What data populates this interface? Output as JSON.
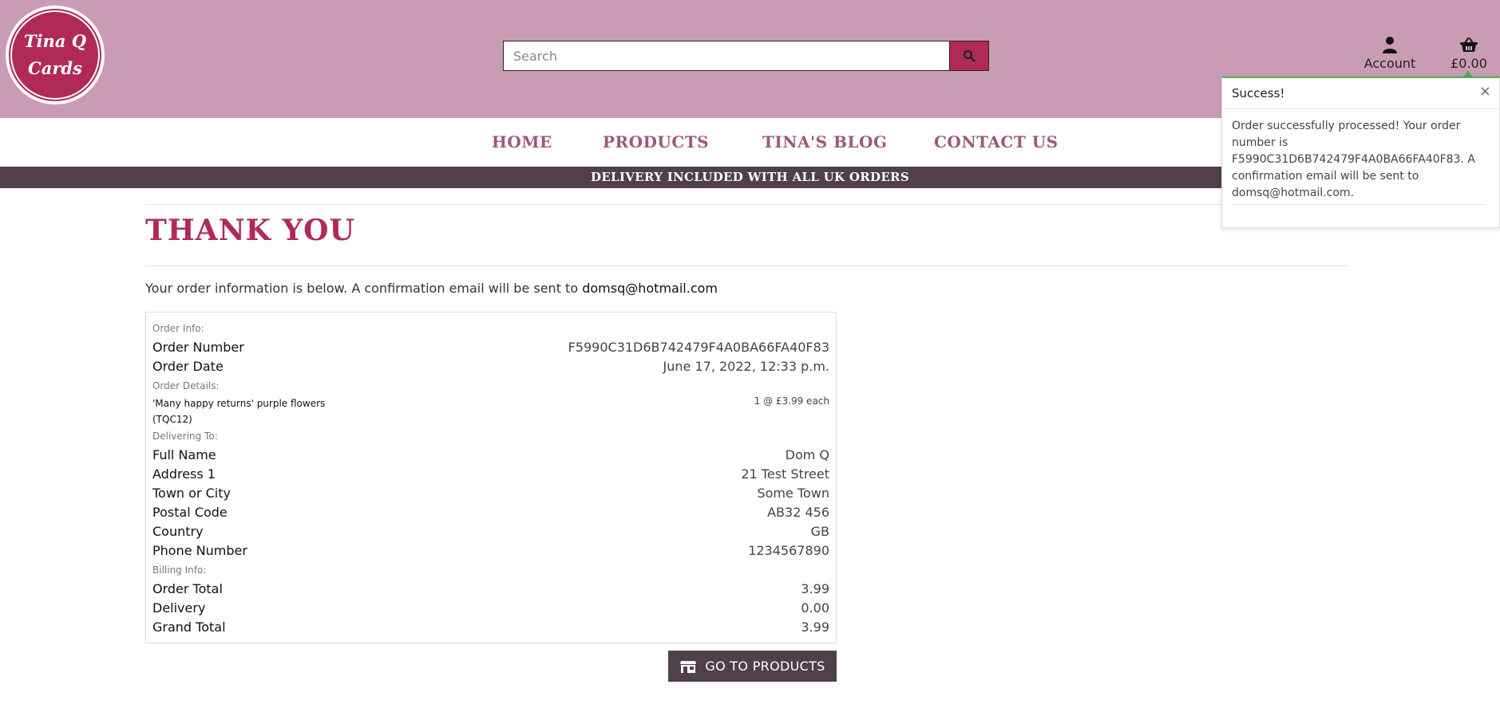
{
  "brand": {
    "logo_line1": "Tina Q",
    "logo_line2": "Cards"
  },
  "header": {
    "search_placeholder": "Search",
    "account_label": "Account",
    "cart_total": "£0.00"
  },
  "nav": {
    "items": [
      "HOME",
      "PRODUCTS",
      "TINA'S BLOG",
      "CONTACT US"
    ]
  },
  "banner": "DELIVERY INCLUDED WITH ALL UK ORDERS",
  "page": {
    "title": "THANK YOU",
    "intro_text": "Your order information is below. A confirmation email will be sent to",
    "email": "domsq@hotmail.com"
  },
  "order": {
    "section_info": "Order Info:",
    "number_label": "Order Number",
    "number_value": "F5990C31D6B742479F4A0BA66FA40F83",
    "date_label": "Order Date",
    "date_value": "June 17, 2022, 12:33 p.m.",
    "section_details": "Order Details:",
    "product_name": "'Many happy returns' purple flowers",
    "product_sku": "(TQC12)",
    "product_qty": "1 @ £3.99 each",
    "section_delivery": "Delivering To:",
    "delivery_rows": [
      {
        "label": "Full Name",
        "value": "Dom Q"
      },
      {
        "label": "Address 1",
        "value": "21 Test Street"
      },
      {
        "label": "Town or City",
        "value": "Some Town"
      },
      {
        "label": "Postal Code",
        "value": "AB32 456"
      },
      {
        "label": "Country",
        "value": "GB"
      },
      {
        "label": "Phone Number",
        "value": "1234567890"
      }
    ],
    "section_billing": "Billing Info:",
    "billing_rows": [
      {
        "label": "Order Total",
        "value": "3.99"
      },
      {
        "label": "Delivery",
        "value": "0.00"
      },
      {
        "label": "Grand Total",
        "value": "3.99"
      }
    ]
  },
  "cta": {
    "label": "GO TO PRODUCTS",
    "icon": "store-icon"
  },
  "toast": {
    "title": "Success!",
    "close": "×",
    "message": "Order successfully processed! Your order number is F5990C31D6B742479F4A0BA66FA40F83. A confirmation email will be sent to domsq@hotmail.com."
  },
  "colors": {
    "header_bg": "#c99cb3",
    "brand": "#b12a55",
    "nav_text": "#a0577d",
    "dark_bar": "#4f404b",
    "success": "#4caf50"
  }
}
